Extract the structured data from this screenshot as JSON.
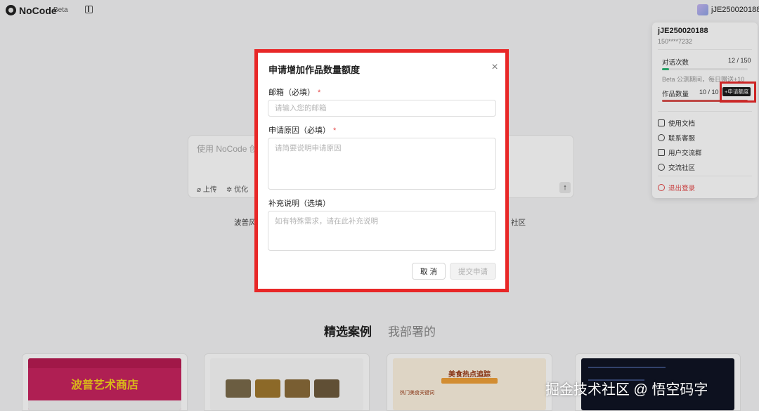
{
  "app": {
    "name": "NoCode",
    "badge": "Beta"
  },
  "header": {
    "username": "jJE250020188"
  },
  "user_panel": {
    "name": "jJE250020188",
    "phone": "150****7232",
    "chat_label": "对话次数",
    "chat_count": "12 / 150",
    "chat_progress": 0.08,
    "hint": "Beta 公测期间，每日赠送+10",
    "works_label": "作品数量",
    "works_count": "10 / 10",
    "works_progress": 1.0,
    "quota_button": "+申请额度",
    "menu": [
      "使用文档",
      "联系客服",
      "用户交流群",
      "交流社区"
    ],
    "logout": "退出登录"
  },
  "composer": {
    "placeholder": "使用 NoCode 创",
    "upload": "上传",
    "optimize": "优化",
    "send": "↑"
  },
  "chips": [
    "波普风",
    "社区"
  ],
  "sections": {
    "featured": "精选案例",
    "deployed": "我部署的"
  },
  "cards": {
    "c1_title": "波普艺术商店",
    "c3_title": "美食热点追踪",
    "c3_sub": "热门美食关键词"
  },
  "watermark": "掘金技术社区 @ 悟空码字",
  "modal": {
    "title": "申请增加作品数量额度",
    "close": "×",
    "email_label": "邮箱（必填）",
    "email_placeholder": "请输入您的邮箱",
    "reason_label": "申请原因（必填）",
    "reason_placeholder": "请简要说明申请原因",
    "extra_label": "补充说明（选填）",
    "extra_placeholder": "如有特殊需求，请在此补充说明",
    "required_mark": "*",
    "cancel": "取 消",
    "submit": "提交申请"
  },
  "colors": {
    "accent": "#e82727",
    "danger": "#e54848",
    "dark": "#1c1c1c"
  }
}
